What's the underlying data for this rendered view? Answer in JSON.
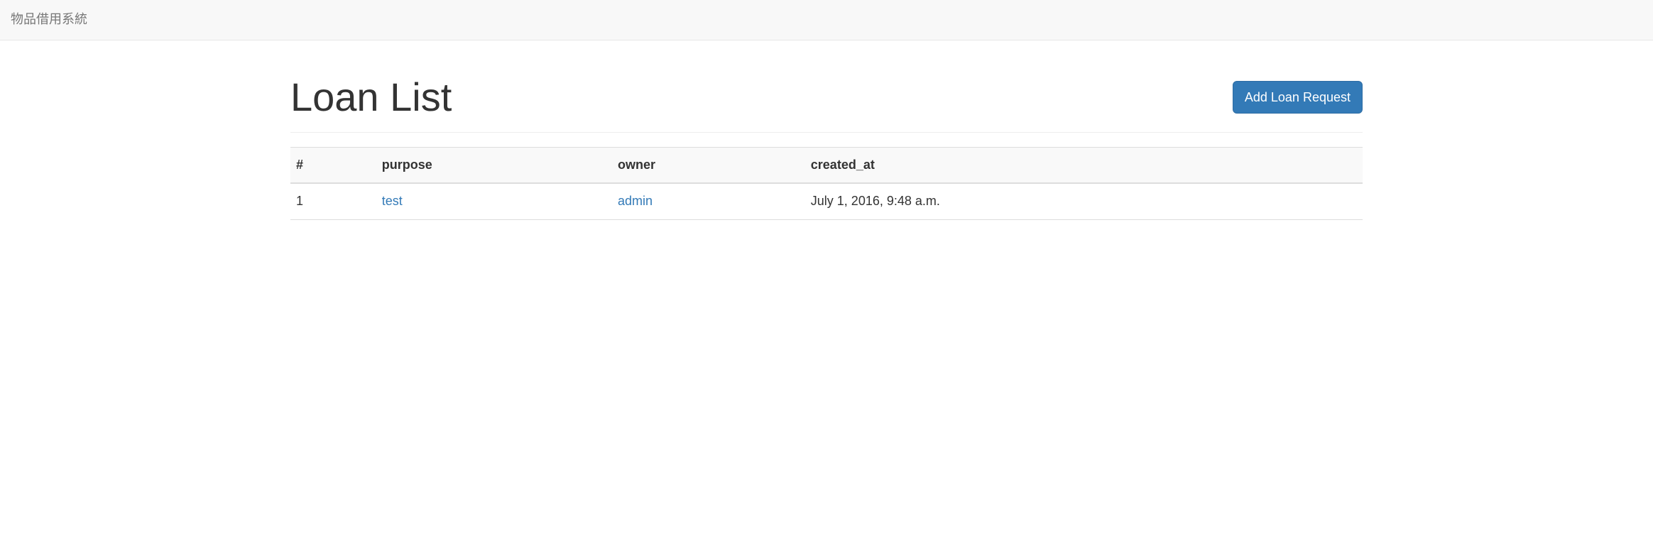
{
  "navbar": {
    "brand": "物品借用系統"
  },
  "page": {
    "title": "Loan List",
    "add_button_label": "Add Loan Request"
  },
  "table": {
    "headers": {
      "num": "#",
      "purpose": "purpose",
      "owner": "owner",
      "created_at": "created_at"
    },
    "rows": [
      {
        "num": "1",
        "purpose": "test",
        "owner": "admin",
        "created_at": "July 1, 2016, 9:48 a.m."
      }
    ]
  }
}
